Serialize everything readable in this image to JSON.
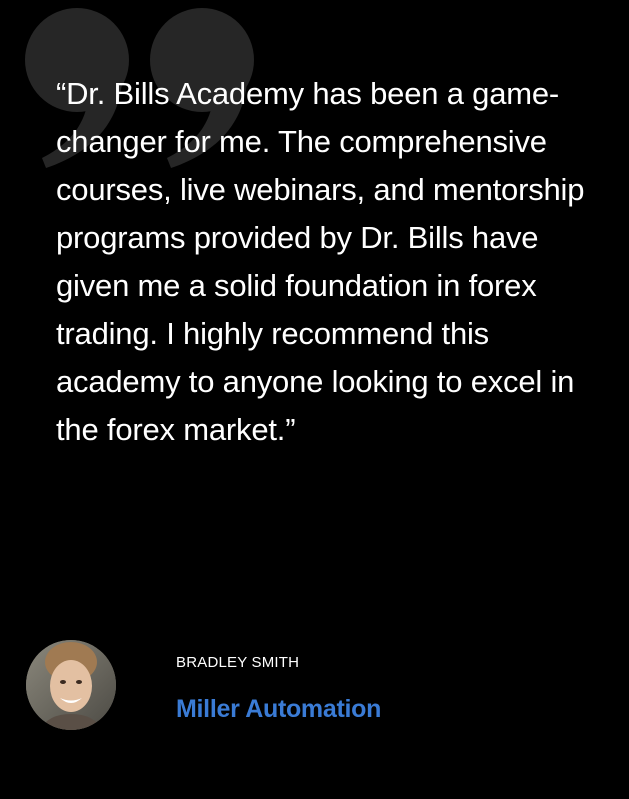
{
  "testimonial": {
    "quote": "“Dr. Bills Academy has been a game-changer for me. The comprehensive courses, live webinars, and mentorship programs provided by Dr. Bills have given me a solid foundation in forex trading. I highly recommend this academy to anyone looking to excel in the forex market.”",
    "quote_icon": "quote-mark-icon",
    "author": {
      "name": "BRADLEY SMITH",
      "company": "Miller Automation",
      "avatar_icon": "avatar-photo"
    }
  },
  "colors": {
    "background": "#000000",
    "text": "#ffffff",
    "quote_mark": "#262626",
    "company": "#3a7bd5"
  }
}
